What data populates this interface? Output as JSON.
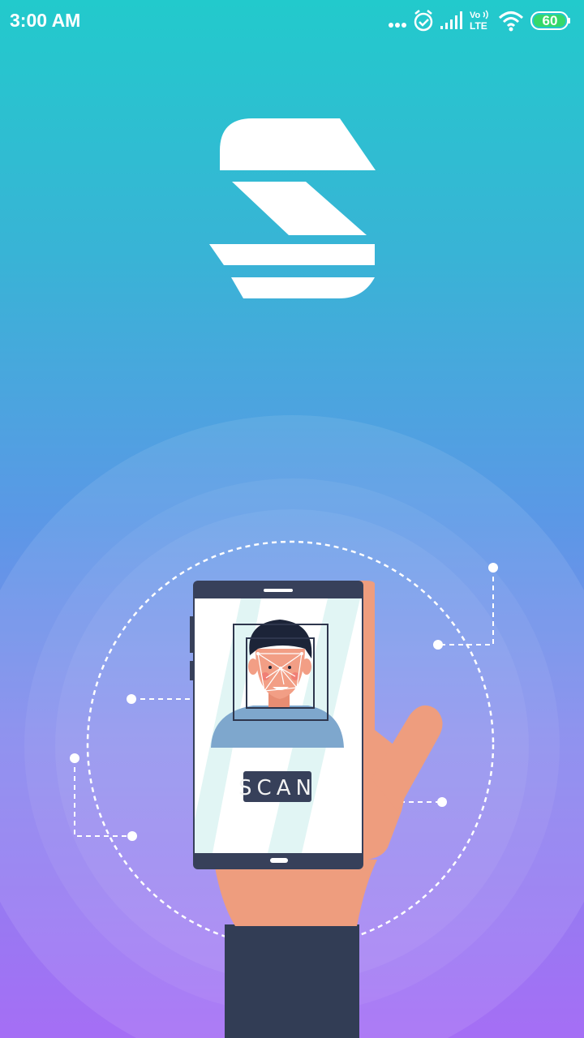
{
  "status_bar": {
    "time": "3:00 AM",
    "battery_level": "60",
    "network_label_top": "Vo",
    "network_label_bottom": "LTE",
    "icons": [
      "more-dots-icon",
      "alarm-icon",
      "signal-icon",
      "volte-icon",
      "wifi-icon",
      "battery-icon"
    ]
  },
  "app": {
    "logo": "app-logo"
  },
  "illustration": {
    "scan_button_label": "SCAN"
  },
  "colors": {
    "gradient_top": "#22cacc",
    "gradient_bottom": "#a56ef5",
    "phone_frame": "#37405a",
    "hand_skin": "#ee9d7e",
    "sleeve": "#323d55",
    "face_skin": "#f29e85"
  }
}
